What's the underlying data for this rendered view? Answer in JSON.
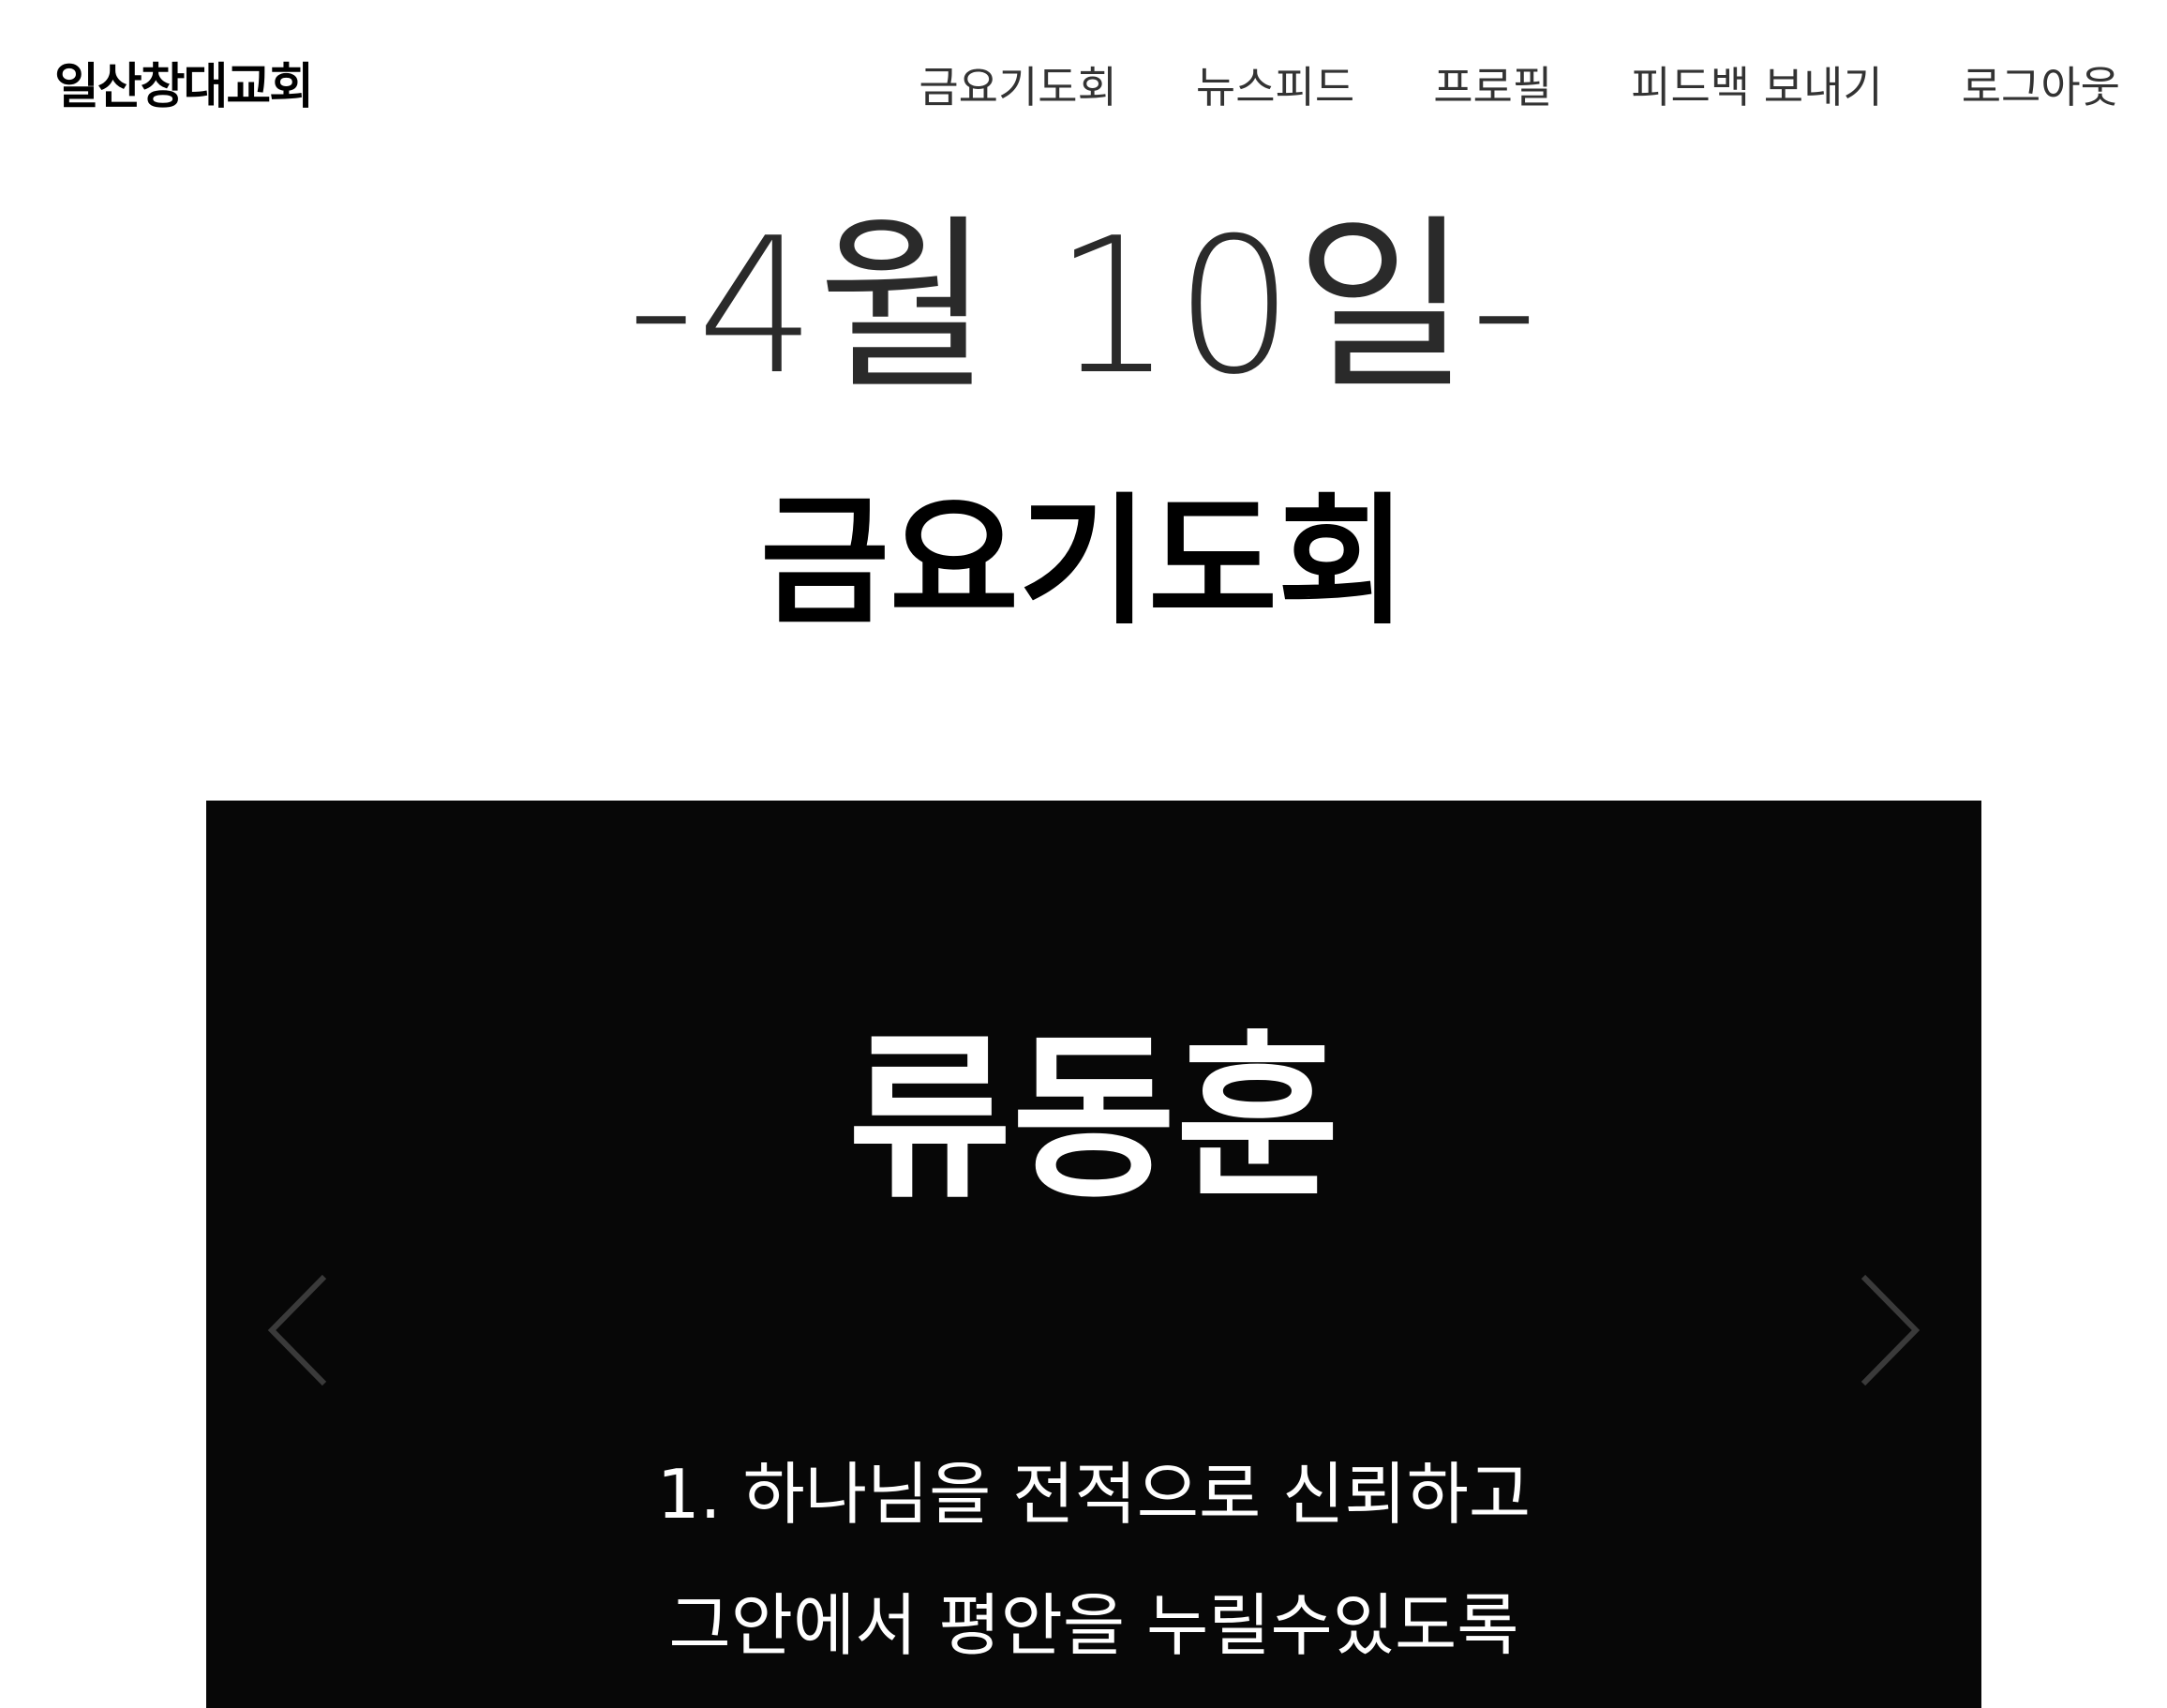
{
  "header": {
    "logo": "일산창대교회",
    "nav": [
      {
        "label": "금요기도회"
      },
      {
        "label": "뉴스피드"
      },
      {
        "label": "프로필"
      },
      {
        "label": "피드백 보내기"
      },
      {
        "label": "로그아웃"
      }
    ]
  },
  "main": {
    "date": "-4월 10일-",
    "title": "금요기도회"
  },
  "slider": {
    "name": "류동훈",
    "lines": [
      "1. 하나님을 전적으로 신뢰하고",
      "그안에서 평안을 누릴수있도록"
    ],
    "prev_icon": "chevron-left-icon",
    "next_icon": "chevron-right-icon",
    "background": "#070707",
    "arrow_color": "#3a3a3a"
  }
}
